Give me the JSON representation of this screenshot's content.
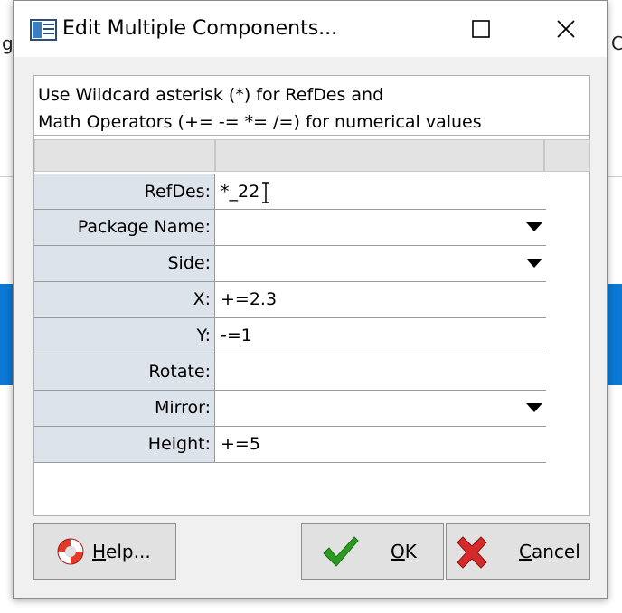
{
  "background": {
    "frag_left": "g",
    "frag_right": "C"
  },
  "window": {
    "title": "Edit Multiple Components..."
  },
  "hint": {
    "line1": "Use Wildcard asterisk (*) for RefDes and",
    "line2": "Math Operators (+= -= *= /=) for numerical values"
  },
  "fields": [
    {
      "label": "RefDes:",
      "value": "*_22"
    },
    {
      "label": "Package Name:",
      "value": ""
    },
    {
      "label": "Side:",
      "value": ""
    },
    {
      "label": "X:",
      "value": "+=2.3"
    },
    {
      "label": "Y:",
      "value": "-=1"
    },
    {
      "label": "Rotate:",
      "value": ""
    },
    {
      "label": "Mirror:",
      "value": ""
    },
    {
      "label": "Height:",
      "value": "+=5"
    }
  ],
  "buttons": {
    "help": {
      "mnemonic": "H",
      "rest": "elp..."
    },
    "ok": {
      "mnemonic": "O",
      "rest": "K"
    },
    "cancel": {
      "mnemonic": "C",
      "rest": "ancel"
    }
  },
  "icons": {
    "help": "lifebuoy-icon",
    "ok": "checkmark-icon",
    "cancel": "red-x-icon"
  },
  "colors": {
    "background_accent": "#0a78d4",
    "label_bg": "#dde3ea",
    "ok_green": "#2d9b22",
    "cancel_red": "#d42a2a"
  }
}
